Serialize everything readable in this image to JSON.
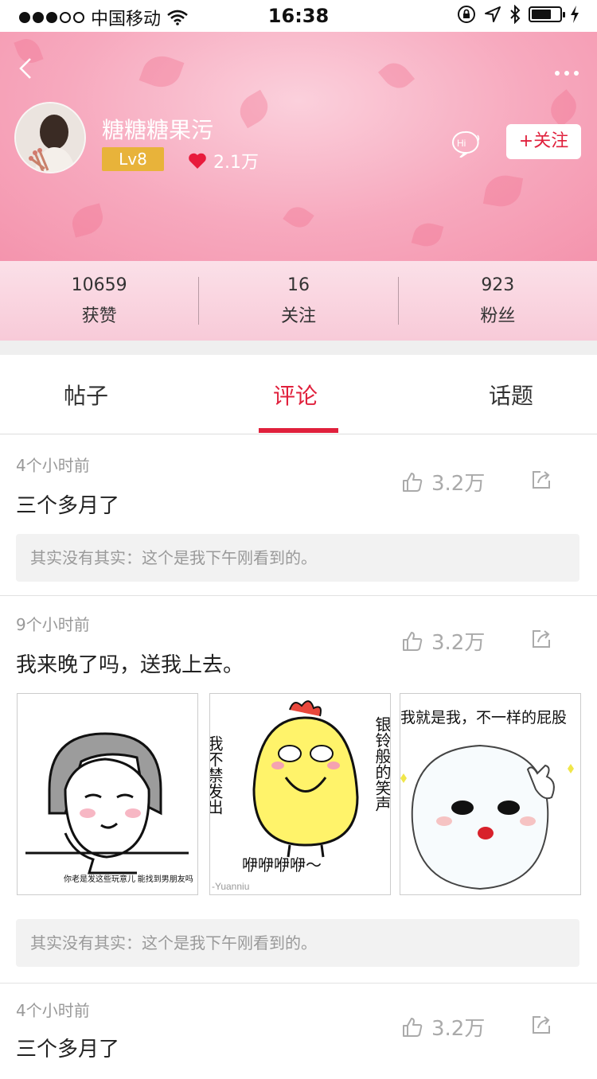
{
  "status_bar": {
    "carrier": "中国移动",
    "time": "16:38"
  },
  "profile": {
    "username": "糖糖糖果污",
    "level": "Lv8",
    "likes": "2.1万",
    "follow_label": "+关注",
    "hi_label": "Hi"
  },
  "stats": [
    {
      "value": "10659",
      "label": "获赞"
    },
    {
      "value": "16",
      "label": "关注"
    },
    {
      "value": "923",
      "label": "粉丝"
    }
  ],
  "tabs": [
    {
      "label": "帖子",
      "active": false
    },
    {
      "label": "评论",
      "active": true
    },
    {
      "label": "话题",
      "active": false
    }
  ],
  "comments": [
    {
      "time": "4个小时前",
      "text": "三个多月了",
      "likes": "3.2万",
      "quote": "其实没有其实：这个是我下午刚看到的。"
    },
    {
      "time": "9个小时前",
      "text": "我来晚了吗，送我上去。",
      "likes": "3.2万",
      "quote": "其实没有其实：这个是我下午刚看到的。",
      "images": [
        {
          "caption": "你老是发这些玩意儿 能找到男朋友吗"
        },
        {
          "caption_left": "我不禁发出",
          "caption_right": "银铃般的笑声",
          "caption_bottom": "咿咿咿咿～",
          "credit": "-Yuanniu"
        },
        {
          "caption": "我就是我，不一样的屁股"
        }
      ]
    },
    {
      "time": "4个小时前",
      "text": "三个多月了",
      "likes": "3.2万"
    }
  ],
  "colors": {
    "accent": "#e0203c",
    "level": "#e8b33a",
    "header_pink": "#f7a9be"
  }
}
